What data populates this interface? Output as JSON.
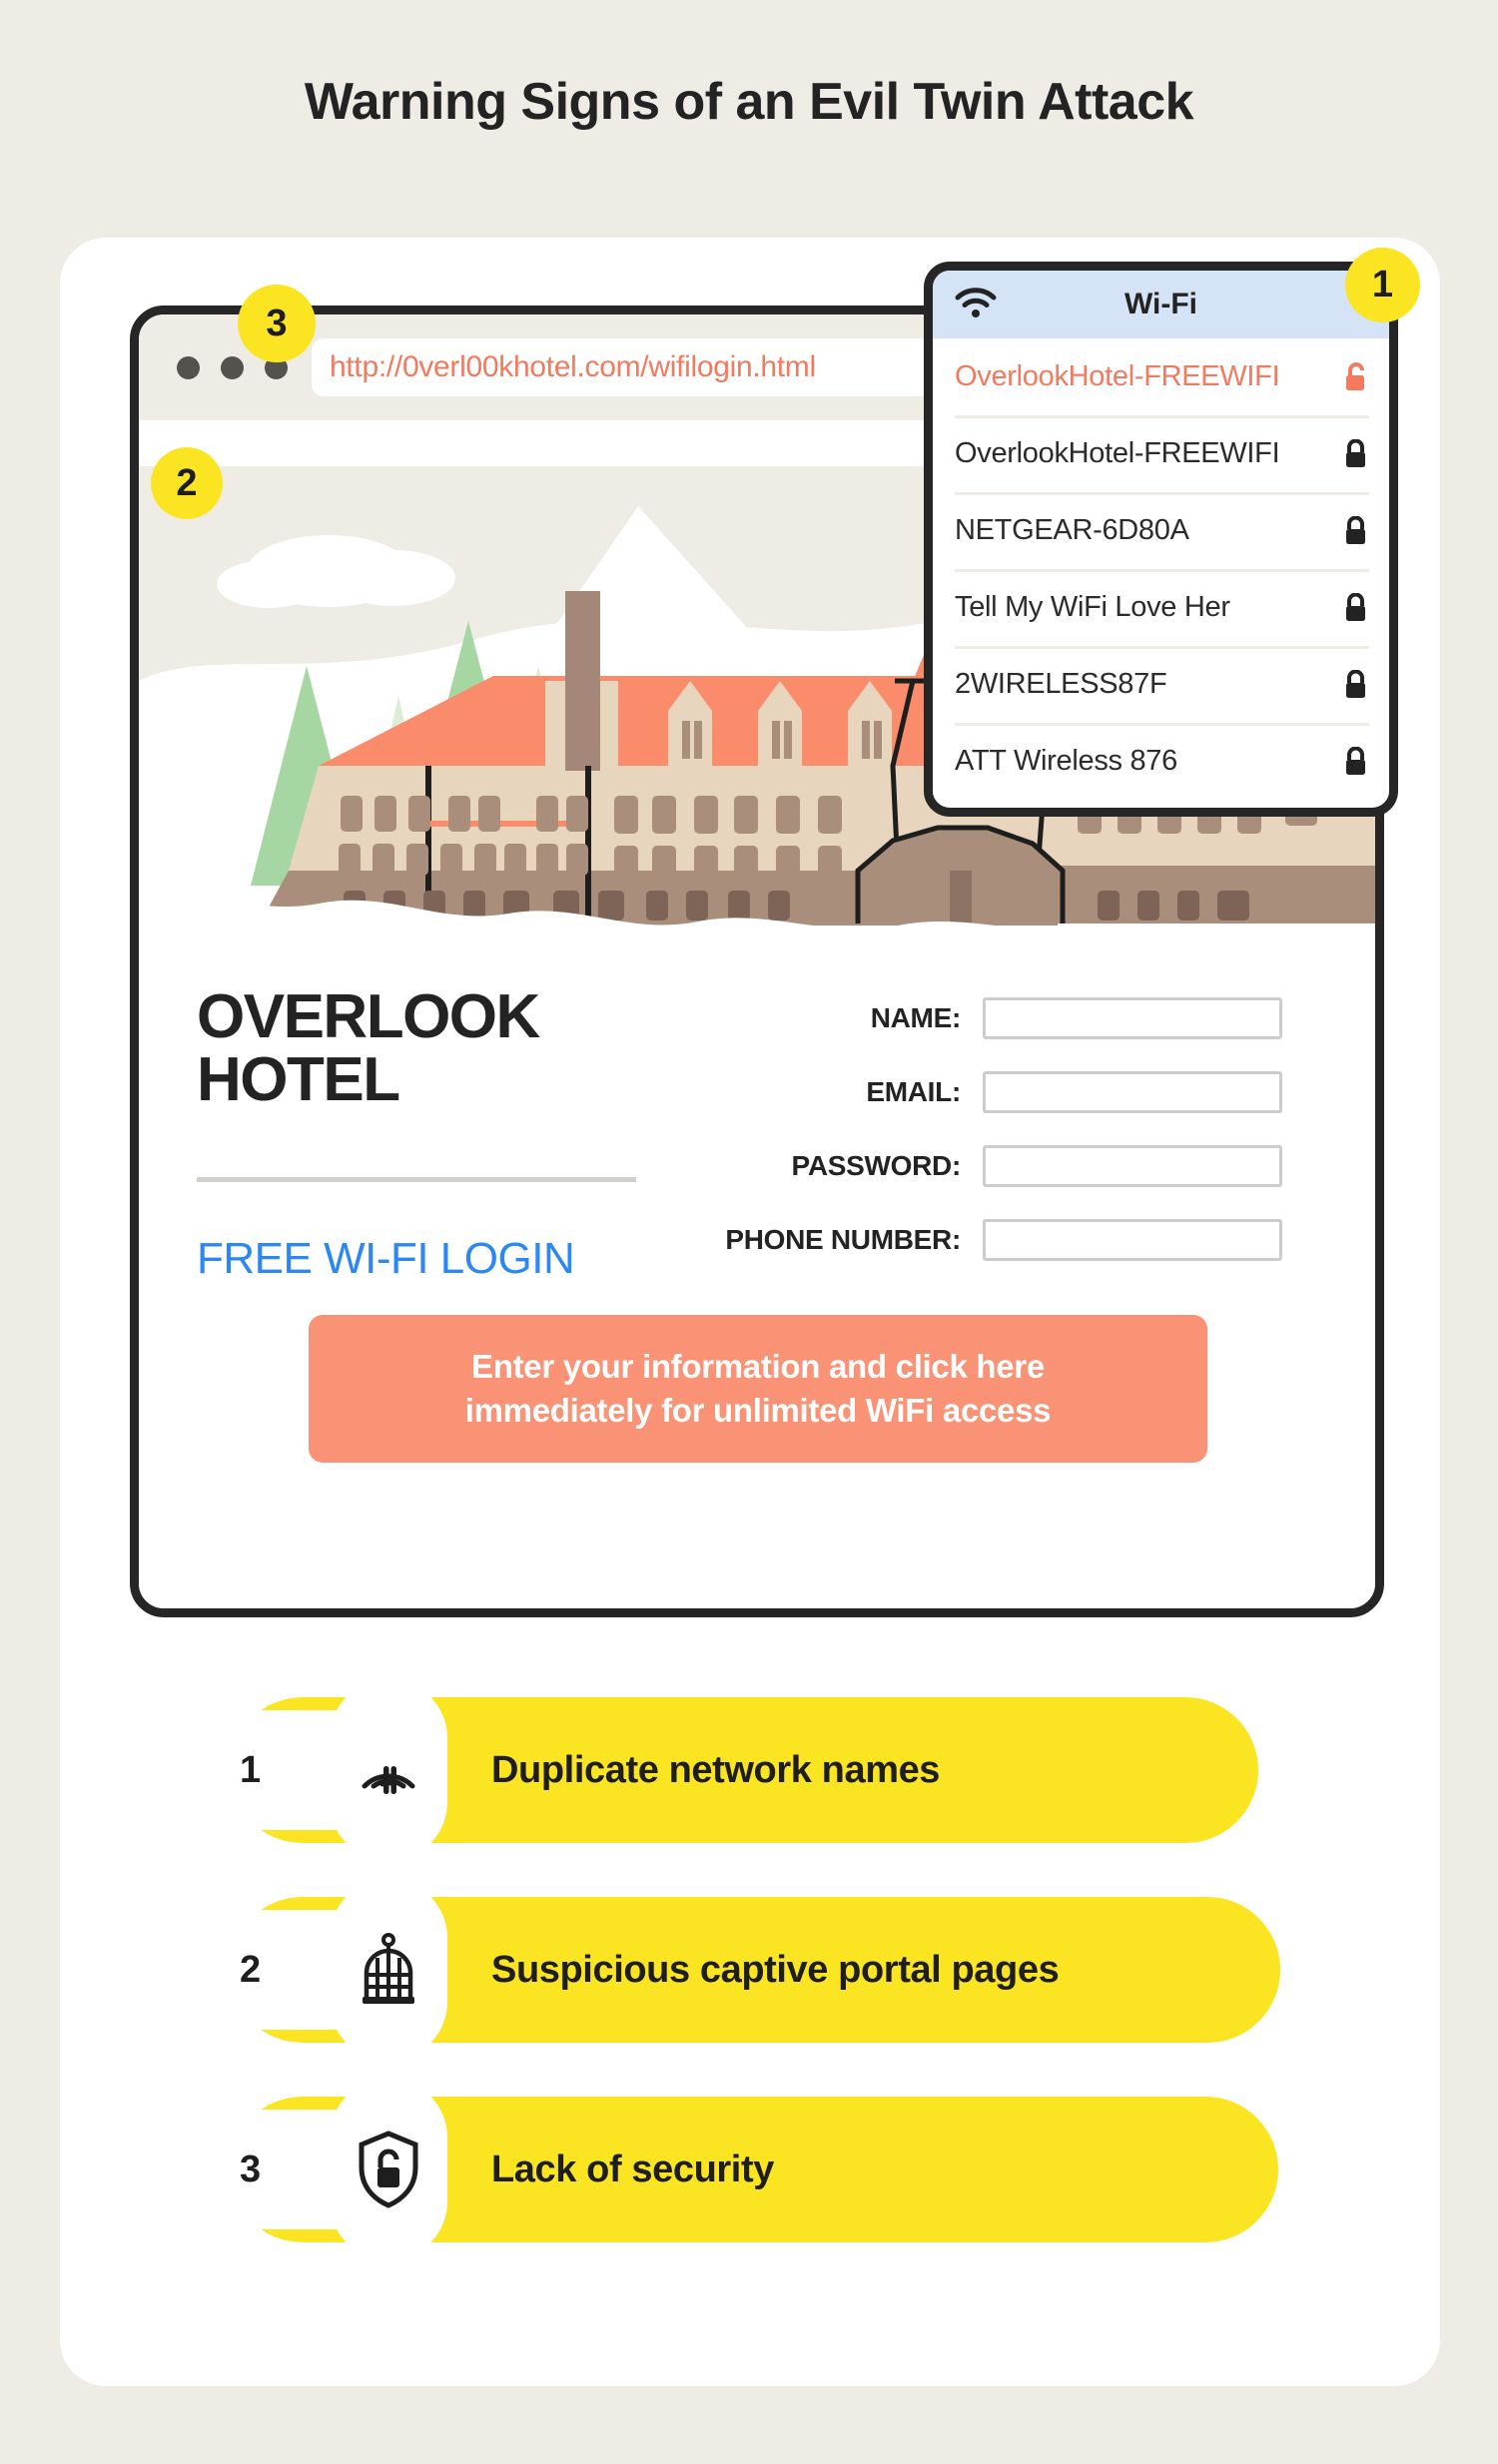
{
  "page": {
    "title": "Warning Signs of an Evil Twin Attack",
    "background_color": "#efebe5",
    "accent_yellow": "#fbe522",
    "accent_coral": "#fa9275",
    "accent_blue": "#2b87f5"
  },
  "browser": {
    "url": "http://0verl00khotel.com/wifilogin.html",
    "url_color": "#f27a5e",
    "dots": [
      "dot",
      "dot",
      "dot"
    ]
  },
  "wifi_panel": {
    "header_title": "Wi-Fi",
    "header_icon": "wifi-icon",
    "header_bg": "#d5e3f7",
    "networks": [
      {
        "name": "OverlookHotel-FREEWIFI",
        "lock": "unlocked",
        "evil": true
      },
      {
        "name": "OverlookHotel-FREEWIFI",
        "lock": "locked",
        "evil": false
      },
      {
        "name": "NETGEAR-6D80A",
        "lock": "locked",
        "evil": false
      },
      {
        "name": "Tell My WiFi Love Her",
        "lock": "locked",
        "evil": false
      },
      {
        "name": "2WIRELESS87F",
        "lock": "locked",
        "evil": false
      },
      {
        "name": "ATT Wireless 876",
        "lock": "locked",
        "evil": false
      }
    ]
  },
  "badges": {
    "one": "1",
    "two": "2",
    "three": "3"
  },
  "portal": {
    "hotel_name_line1": "OVERLOOK",
    "hotel_name_line2": "HOTEL",
    "tagline": "FREE WI-FI LOGIN",
    "fields": [
      {
        "label": "NAME:",
        "value": "",
        "placeholder": ""
      },
      {
        "label": "EMAIL:",
        "value": "",
        "placeholder": ""
      },
      {
        "label": "PASSWORD:",
        "value": "",
        "placeholder": ""
      },
      {
        "label": "PHONE NUMBER:",
        "value": "",
        "placeholder": ""
      }
    ],
    "cta_line1": "Enter your information and click here",
    "cta_line2": "immediately for unlimited WiFi access"
  },
  "warning_signs": [
    {
      "number": "1",
      "label": "Duplicate network names",
      "icon": "broadcast-signal-icon"
    },
    {
      "number": "2",
      "label": "Suspicious captive portal pages",
      "icon": "birdcage-icon"
    },
    {
      "number": "3",
      "label": "Lack of security",
      "icon": "shield-unlocked-icon"
    }
  ]
}
